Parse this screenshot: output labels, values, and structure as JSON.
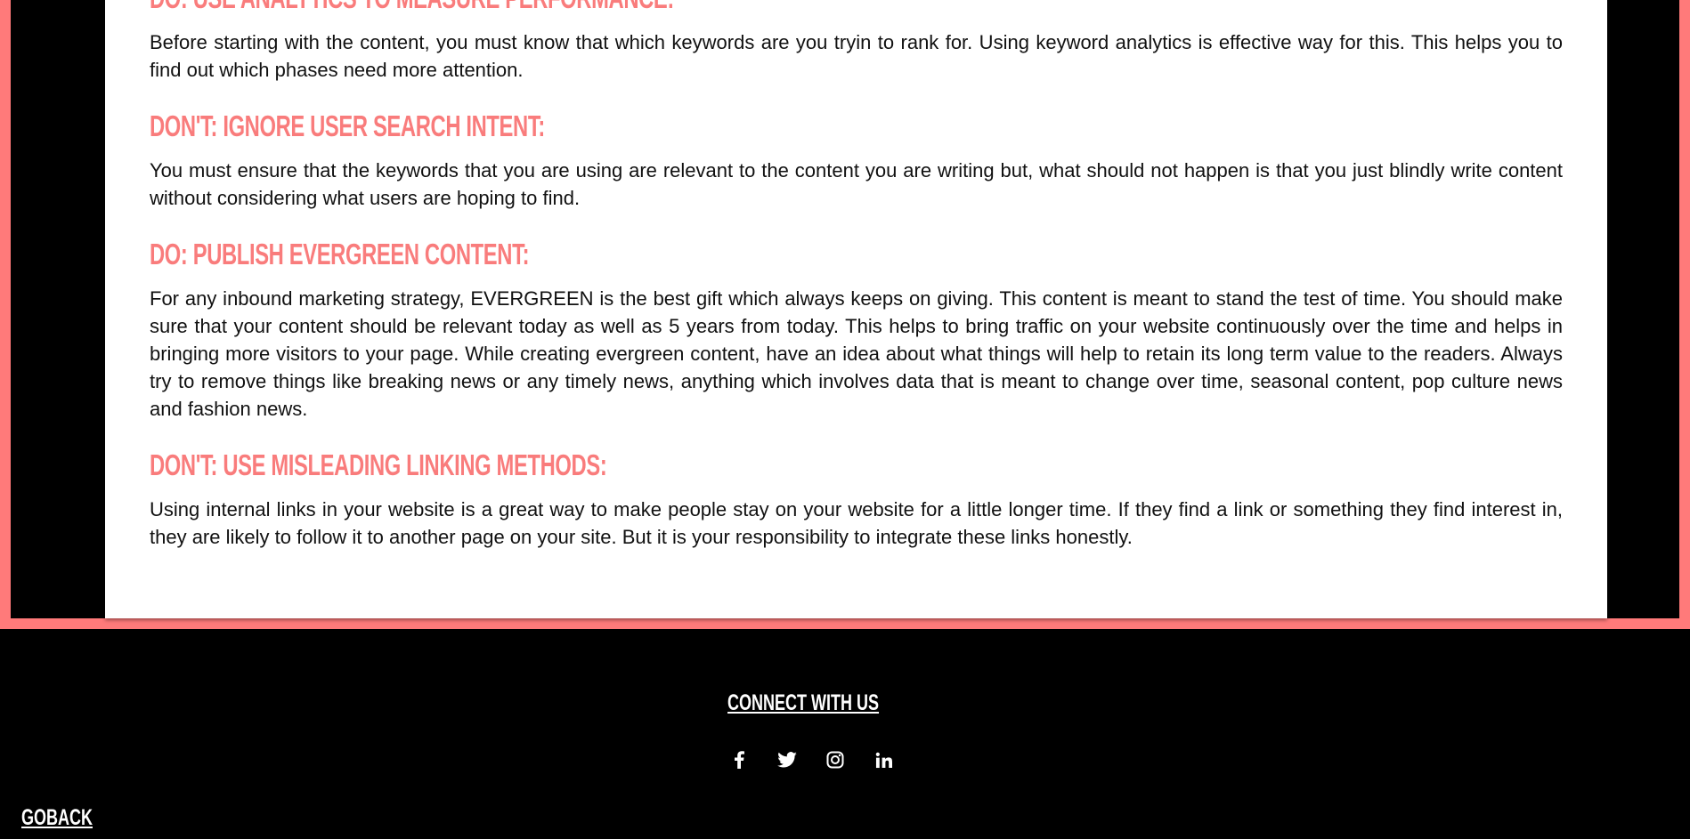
{
  "article": {
    "sections": [
      {
        "heading": "DO: USE ANALYTICS TO MEASURE PERFORMANCE:",
        "body": "Before starting with the content, you must know that which keywords are you tryin to rank for. Using keyword analytics is effective way for this. This helps you to find out which phases need more attention."
      },
      {
        "heading": "DON'T: IGNORE USER SEARCH INTENT:",
        "body": "You must ensure that the keywords that you are using are relevant to the content you are writing but, what should not happen is that you just blindly write content without considering what users are hoping to find."
      },
      {
        "heading": "DO: PUBLISH EVERGREEN CONTENT:",
        "body": "For any inbound marketing strategy, EVERGREEN is the best gift which always keeps on giving. This content is meant to stand the test of time. You should make sure that your content should be relevant today as well as 5 years from today. This helps to bring traffic on your website continuously over the time and helps in bringing more visitors to your page. While creating evergreen content, have an idea about what things will help to retain its long term value to the readers. Always try to remove things like breaking news or any timely news, anything which involves data that is meant to change over time, seasonal content, pop culture news and fashion news."
      },
      {
        "heading": "DON'T: USE MISLEADING LINKING METHODS:",
        "body": "Using internal links in your website is a great way to make people stay on your website for a little longer time. If they find a link or something they find interest in, they are likely to follow it to another page on your site. But it is your responsibility to integrate these links honestly."
      }
    ]
  },
  "footer": {
    "connect_label": "CONNECT WITH US",
    "socials": [
      "facebook-icon",
      "twitter-icon",
      "instagram-icon",
      "linkedin-icon"
    ],
    "goback_label": "GOBACK"
  },
  "colors": {
    "accent": "#f97c7c",
    "frame": "#ff7a7a",
    "background": "#000000"
  }
}
